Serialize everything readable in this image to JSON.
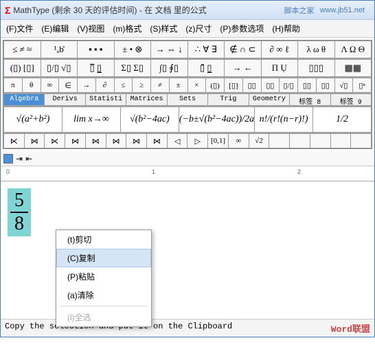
{
  "titlebar": {
    "sigma": "Σ",
    "title": "MathType (剩余 30 天的评估时间) - 在 文档 里的公式",
    "url": "www.jb51.net",
    "url_label": "脚本之家"
  },
  "menubar": [
    "(F)文件",
    "(E)编辑",
    "(V)视图",
    "(m)格式",
    "(S)样式",
    "(z)尺寸",
    "(P)参数选项",
    "(H)帮助"
  ],
  "toolbars": {
    "row1": [
      "≤ ≠ ≈",
      "¹ₐb̊",
      "▪ ▪ ▪",
      "± • ⊗",
      "→ ⇔ ↓",
      "∴ ∀ ∃",
      "∉ ∩ ⊂",
      "∂ ∞ ℓ",
      "λ ω θ",
      "Λ Ω Θ"
    ],
    "row2": [
      "(▯) [▯]",
      "▯/▯ √▯",
      "▯̅ ▯̲",
      "Σ▯ Σ▯",
      "∫▯ ∮▯",
      "▯̄ ▯̲",
      "→ ←",
      "Π Ụ",
      "▯▯▯",
      "▦▦"
    ],
    "row3": [
      "π",
      "θ",
      "∞",
      "∈",
      "→",
      "∂",
      "≤",
      "≥",
      "≠",
      "±",
      "×",
      "(▯)",
      "[▯]",
      "▯▯",
      "▯▯",
      "▯/▯",
      "▯▯",
      "▯▯",
      "√▯",
      "▯ⁿ"
    ],
    "tabs": [
      "Algebra",
      "Derivs",
      "Statisti",
      "Matrices",
      "Sets",
      "Trig",
      "Geometry",
      "标签 8",
      "标签 9"
    ],
    "formulas": [
      "√(a²+b²)",
      "lim x→∞",
      "√(b²−4ac)",
      "(−b±√(b²−4ac))/2a",
      "n!/(r!(n−r)!)",
      "1/2"
    ],
    "row5": [
      "⋉",
      "⋈",
      "⋉",
      "⋈",
      "⋈",
      "⋈",
      "⋈",
      "⋈",
      "◁",
      "▷",
      "[0,1]",
      "∞",
      "√2",
      "",
      "",
      "",
      "",
      ""
    ]
  },
  "ruler": {
    "m0": "0",
    "m1": "1",
    "m2": "2"
  },
  "equation": {
    "numerator": "5",
    "denominator": "8"
  },
  "context_menu": {
    "items": [
      {
        "label": "(t)剪切",
        "hl": false,
        "dis": false
      },
      {
        "label": "(C)复制",
        "hl": true,
        "dis": false
      },
      {
        "label": "(P)粘贴",
        "hl": false,
        "dis": false
      },
      {
        "label": "(a)清除",
        "hl": false,
        "dis": false
      },
      {
        "label": "(l)全选",
        "hl": false,
        "dis": true
      }
    ]
  },
  "statusbar": {
    "text": "Copy the selection and put it on the Clipboard",
    "watermark": "Word联盟"
  }
}
